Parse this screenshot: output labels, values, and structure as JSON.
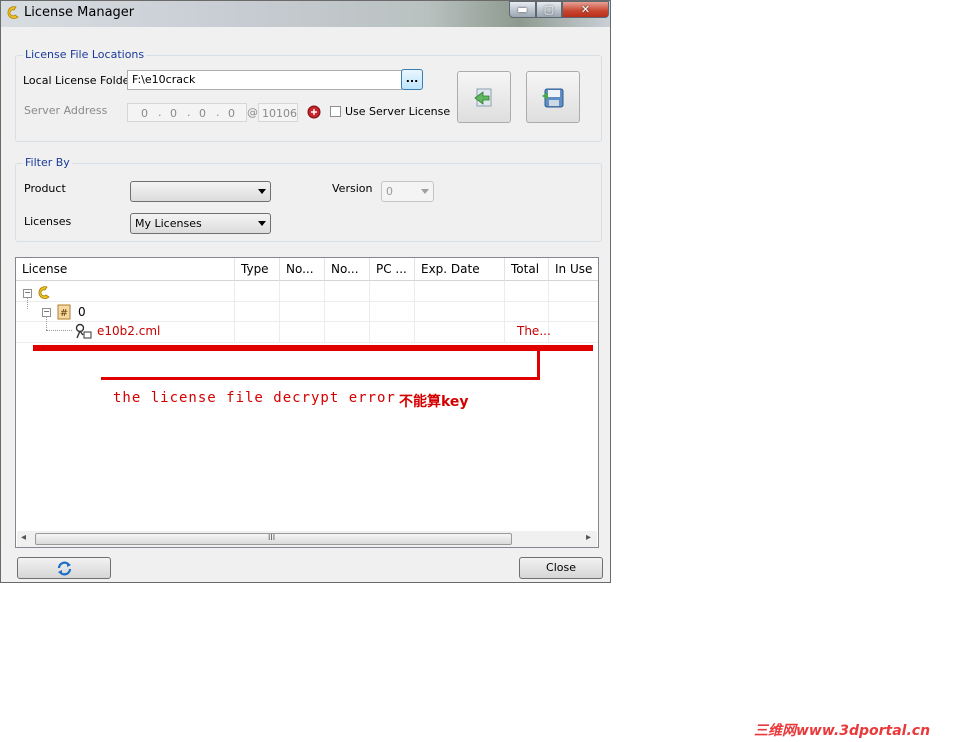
{
  "window": {
    "title": "License Manager",
    "minimize_glyph": "▬",
    "maximize_glyph": "▢",
    "close_glyph": "✕"
  },
  "license_locations": {
    "group_title": "License File Locations",
    "local_folder_label": "Local License Folder",
    "local_folder_value": "F:\\e10crack",
    "browse_label": "...",
    "server_address_label": "Server Address",
    "ip": [
      "0",
      "0",
      "0",
      "0"
    ],
    "at_sign": "@",
    "port": "10106",
    "use_server_label": "Use Server License",
    "use_server_checked": false
  },
  "filter": {
    "group_title": "Filter By",
    "product_label": "Product",
    "product_value": "",
    "version_label": "Version",
    "version_value": "0",
    "licenses_label": "Licenses",
    "licenses_value": "My Licenses"
  },
  "list": {
    "columns": [
      "License",
      "Type",
      "No...",
      "No...",
      "PC ...",
      "Exp. Date",
      "Total",
      "In Use"
    ],
    "rows": [
      {
        "label": "",
        "icon": "product-icon",
        "expander": "−"
      },
      {
        "label": "0",
        "icon": "hash-folder-icon",
        "expander": "−"
      },
      {
        "label": "e10b2.cml",
        "icon": "license-key-icon",
        "total": "The..."
      }
    ],
    "scroll_grip": "III",
    "scroll_left": "◂",
    "scroll_right": "▸"
  },
  "footer": {
    "refresh_icon": "refresh-icon",
    "close_label": "Close"
  },
  "annotation": {
    "english": "the license file decrypt error",
    "chinese": "不能算key",
    "color": "#d40000"
  },
  "watermark": "三维网www.3dportal.cn"
}
